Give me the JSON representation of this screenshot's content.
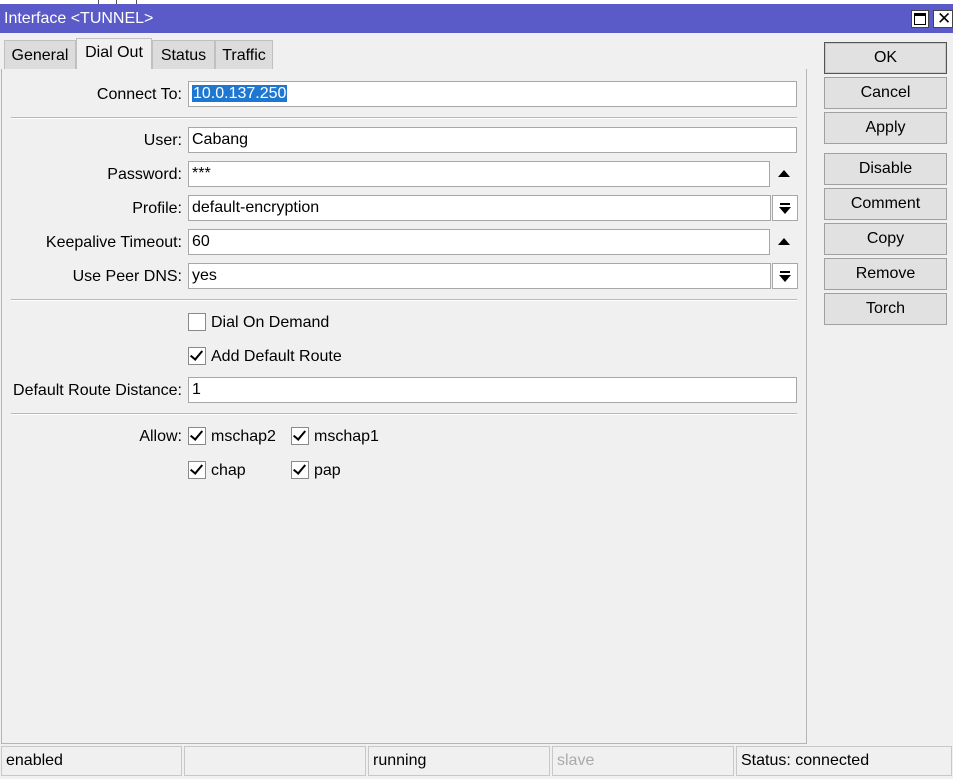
{
  "window": {
    "title": "Interface <TUNNEL>"
  },
  "tabs": [
    {
      "label": "General"
    },
    {
      "label": "Dial Out"
    },
    {
      "label": "Status"
    },
    {
      "label": "Traffic"
    }
  ],
  "active_tab": "Dial Out",
  "form": {
    "connect_to": {
      "label": "Connect To:",
      "value": "10.0.137.250"
    },
    "user": {
      "label": "User:",
      "value": "Cabang"
    },
    "password": {
      "label": "Password:",
      "value": "***"
    },
    "profile": {
      "label": "Profile:",
      "value": "default-encryption"
    },
    "keepalive_timeout": {
      "label": "Keepalive Timeout:",
      "value": "60"
    },
    "use_peer_dns": {
      "label": "Use Peer DNS:",
      "value": "yes"
    },
    "dial_on_demand": {
      "label": "Dial On Demand",
      "checked": false
    },
    "add_default_route": {
      "label": "Add Default Route",
      "checked": true
    },
    "default_route_distance": {
      "label": "Default Route Distance:",
      "value": "1"
    },
    "allow": {
      "label": "Allow:",
      "options": [
        {
          "label": "mschap2",
          "checked": true
        },
        {
          "label": "mschap1",
          "checked": true
        },
        {
          "label": "chap",
          "checked": true
        },
        {
          "label": "pap",
          "checked": true
        }
      ]
    }
  },
  "buttons": {
    "ok": "OK",
    "cancel": "Cancel",
    "apply": "Apply",
    "disable": "Disable",
    "comment": "Comment",
    "copy": "Copy",
    "remove": "Remove",
    "torch": "Torch"
  },
  "statusbar": {
    "state": "enabled",
    "empty": "",
    "running": "running",
    "slave": "slave",
    "status": "Status: connected"
  },
  "colors": {
    "titlebar": "#5a5ac8",
    "selection": "#1e78d2"
  }
}
